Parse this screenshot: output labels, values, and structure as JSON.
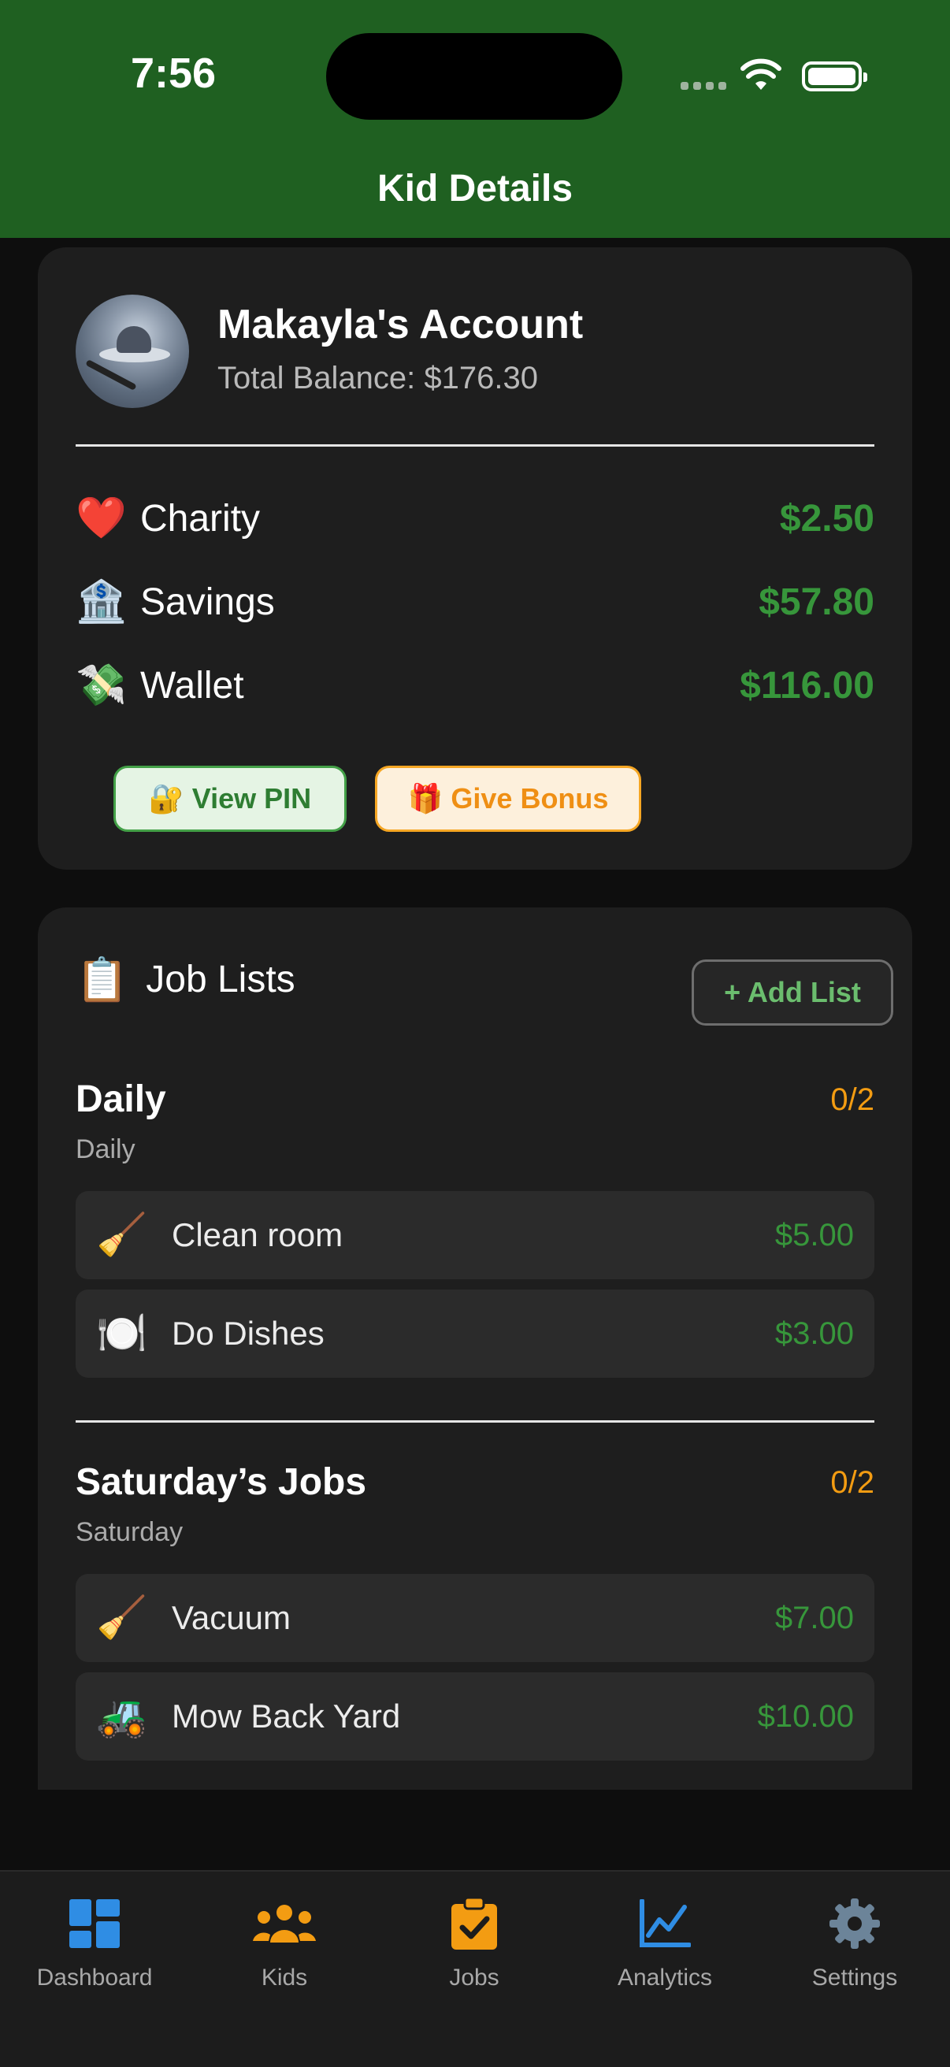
{
  "status_bar": {
    "time": "7:56"
  },
  "header": {
    "title": "Kid Details"
  },
  "account": {
    "name": "Makayla's Account",
    "total_balance": "Total Balance: $176.30",
    "buckets": [
      {
        "icon": "heart-icon",
        "emoji": "❤️",
        "label": "Charity",
        "amount": "$2.50"
      },
      {
        "icon": "bank-icon",
        "emoji": "🏦",
        "label": "Savings",
        "amount": "$57.80"
      },
      {
        "icon": "money-wings-icon",
        "emoji": "💸",
        "label": "Wallet",
        "amount": "$116.00"
      }
    ],
    "view_pin": {
      "emoji": "🔐",
      "label": "View PIN"
    },
    "give_bonus": {
      "emoji": "🎁",
      "label": "Give Bonus"
    }
  },
  "job_lists": {
    "emoji": "📋",
    "title": "Job Lists",
    "add_list_label": "+ Add List",
    "lists": [
      {
        "name": "Daily",
        "schedule": "Daily",
        "progress": "0/2",
        "jobs": [
          {
            "emoji": "🧹",
            "label": "Clean room",
            "amount": "$5.00"
          },
          {
            "emoji": "🍽️",
            "label": "Do Dishes",
            "amount": "$3.00"
          }
        ]
      },
      {
        "name": "Saturday’s Jobs",
        "schedule": "Saturday",
        "progress": "0/2",
        "jobs": [
          {
            "emoji": "🧹",
            "label": "Vacuum",
            "amount": "$7.00"
          },
          {
            "emoji": "🚜",
            "label": "Mow Back Yard",
            "amount": "$10.00"
          }
        ]
      }
    ]
  },
  "tabs": [
    {
      "icon": "dashboard-icon",
      "label": "Dashboard",
      "color": "#2f8de4"
    },
    {
      "icon": "people-icon",
      "label": "Kids",
      "color": "#f39c12"
    },
    {
      "icon": "clipboard-check-icon",
      "label": "Jobs",
      "color": "#f39c12"
    },
    {
      "icon": "chart-line-icon",
      "label": "Analytics",
      "color": "#2f8de4"
    },
    {
      "icon": "gear-icon",
      "label": "Settings",
      "color": "#6c8499"
    }
  ],
  "colors": {
    "header_green": "#1f6021",
    "amount_green": "#37963b",
    "progress_orange": "#f39c12"
  }
}
